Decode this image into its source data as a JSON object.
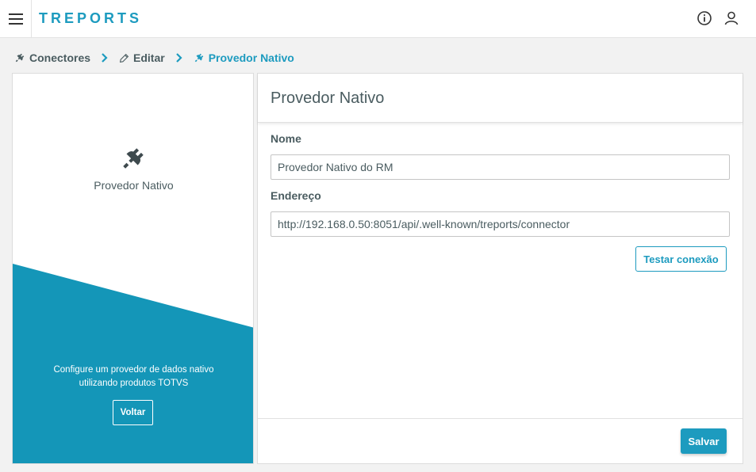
{
  "app": {
    "title": "TREPORTS",
    "accent_color": "#1d9bbf",
    "menu_icon": "hamburger-icon",
    "info_icon": "info-icon",
    "user_icon": "user-icon"
  },
  "breadcrumb": [
    {
      "label": "Conectores",
      "icon": "plug-icon"
    },
    {
      "label": "Editar",
      "icon": "pencil-icon"
    },
    {
      "label": "Provedor Nativo",
      "icon": "plug-icon"
    }
  ],
  "left_panel": {
    "provider_name": "Provedor Nativo",
    "description_line1": "Configure um provedor de dados nativo",
    "description_line2": "utilizando produtos TOTVS",
    "back_label": "Voltar",
    "panel_color": "#1496b8"
  },
  "form": {
    "title": "Provedor Nativo",
    "name_label": "Nome",
    "name_value": "Provedor Nativo do RM",
    "address_label": "Endereço",
    "address_value": "http://192.168.0.50:8051/api/.well-known/treports/connector",
    "test_label": "Testar conexão",
    "save_label": "Salvar"
  }
}
